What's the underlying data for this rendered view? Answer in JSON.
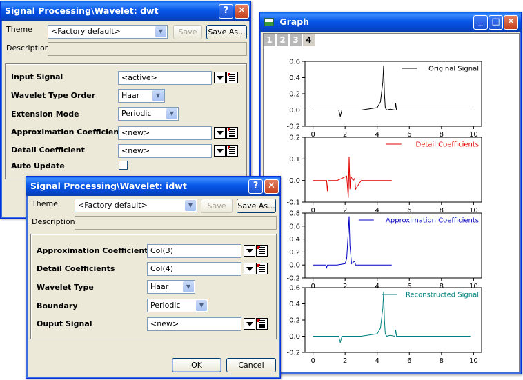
{
  "dwt_dialog": {
    "title": "Signal Processing\\Wavelet:  dwt",
    "theme_label": "Theme",
    "theme_value": "<Factory default>",
    "save_label": "Save",
    "save_as_label": "Save As...",
    "description_label": "Description",
    "rows": [
      {
        "label": "Input Signal",
        "value": "<active>"
      },
      {
        "label": "Wavelet Type  Order",
        "value": "Haar"
      },
      {
        "label": "Extension Mode",
        "value": "Periodic"
      },
      {
        "label": "Approximation Coefficient",
        "value": "<new>"
      },
      {
        "label": "Detail Coefficient",
        "value": "<new>"
      },
      {
        "label": "Auto Update",
        "value": ""
      }
    ]
  },
  "idwt_dialog": {
    "title": "Signal Processing\\Wavelet:  idwt",
    "theme_label": "Theme",
    "theme_value": "<Factory default>",
    "save_label": "Save",
    "save_as_label": "Save As...",
    "description_label": "Description",
    "rows": [
      {
        "label": "Approximation Coefficients",
        "value": "Col(3)"
      },
      {
        "label": "Detail Coefficients",
        "value": "Col(4)"
      },
      {
        "label": "Wavelet Type",
        "value": "Haar"
      },
      {
        "label": "Boundary",
        "value": "Periodic"
      },
      {
        "label": "Ouput Signal",
        "value": "<new>"
      }
    ],
    "ok_label": "OK",
    "cancel_label": "Cancel"
  },
  "graph_window": {
    "title": "Graph",
    "page_tabs": [
      "1",
      "2",
      "3",
      "4"
    ],
    "active_tab": "4"
  },
  "chart_data": [
    {
      "type": "line",
      "series": [
        {
          "name": "Original Signal",
          "color": "#000000",
          "x": [
            0,
            1,
            1.6,
            1.7,
            1.8,
            2,
            3,
            4,
            4.2,
            4.35,
            4.4,
            4.45,
            4.5,
            4.6,
            4.8,
            5.1,
            5.15,
            5.2,
            6,
            7,
            8,
            9,
            9.8
          ],
          "y": [
            0,
            0,
            0,
            -0.08,
            0,
            0,
            0,
            0.03,
            0.1,
            0.35,
            0.55,
            0.2,
            0.03,
            0.0,
            0.01,
            0.0,
            0.08,
            0.0,
            0.0,
            0.0,
            0.0,
            0.0,
            0.0
          ]
        }
      ],
      "xlim": [
        -0.5,
        10.5
      ],
      "ylim": [
        -0.2,
        0.6
      ],
      "xticks": [
        0,
        2,
        4,
        6,
        8,
        10
      ],
      "yticks": [
        -0.2,
        0.0,
        0.2,
        0.4,
        0.6
      ],
      "legend": "top-right"
    },
    {
      "type": "line",
      "series": [
        {
          "name": "Detail Coefficients",
          "color": "#e00000",
          "x": [
            0,
            0.5,
            0.85,
            0.9,
            0.95,
            1.5,
            2.1,
            2.2,
            2.25,
            2.3,
            2.35,
            2.5,
            2.6,
            2.65,
            3,
            4,
            4.9
          ],
          "y": [
            0,
            0,
            0,
            -0.05,
            0,
            0,
            0.02,
            -0.08,
            0.11,
            -0.04,
            0.02,
            0,
            0.01,
            -0.04,
            0,
            0,
            0
          ]
        }
      ],
      "xlim": [
        -0.5,
        10.5
      ],
      "ylim": [
        -0.1,
        0.2
      ],
      "xticks": [
        0,
        2,
        4,
        6,
        8,
        10
      ],
      "yticks": [
        -0.1,
        0.0,
        0.1,
        0.2
      ],
      "legend": "top-right"
    },
    {
      "type": "line",
      "series": [
        {
          "name": "Approximation Coefficients",
          "color": "#0000c0",
          "x": [
            0,
            0.8,
            0.85,
            0.9,
            1.5,
            2.0,
            2.1,
            2.2,
            2.25,
            2.3,
            2.4,
            2.6,
            2.65,
            3.5,
            4.9
          ],
          "y": [
            0,
            0,
            -0.04,
            0,
            0,
            0.02,
            0.1,
            0.5,
            0.75,
            0.3,
            0.02,
            0.06,
            0.0,
            0,
            0
          ]
        }
      ],
      "xlim": [
        -0.5,
        10.5
      ],
      "ylim": [
        -0.2,
        0.8
      ],
      "xticks": [
        0,
        2,
        4,
        6,
        8,
        10
      ],
      "yticks": [
        -0.2,
        0.0,
        0.2,
        0.4,
        0.6,
        0.8
      ],
      "legend": "top-right"
    },
    {
      "type": "line",
      "series": [
        {
          "name": "Reconstructed Signal",
          "color": "#008080",
          "x": [
            0,
            1,
            1.6,
            1.7,
            1.8,
            2,
            3,
            4,
            4.2,
            4.35,
            4.4,
            4.45,
            4.5,
            4.6,
            4.8,
            5.1,
            5.15,
            5.2,
            6,
            7,
            8,
            9,
            9.8
          ],
          "y": [
            0,
            0,
            0,
            -0.08,
            0,
            0,
            0,
            0.03,
            0.1,
            0.35,
            0.55,
            0.2,
            0.03,
            0.0,
            0.01,
            0.0,
            0.08,
            0.0,
            0.0,
            0.0,
            0.0,
            0.0,
            0.0
          ]
        }
      ],
      "xlim": [
        -0.5,
        10.5
      ],
      "ylim": [
        -0.2,
        0.6
      ],
      "xticks": [
        0,
        2,
        4,
        6,
        8,
        10
      ],
      "yticks": [
        -0.2,
        0.0,
        0.2,
        0.4,
        0.6
      ],
      "legend": "top-right"
    }
  ]
}
